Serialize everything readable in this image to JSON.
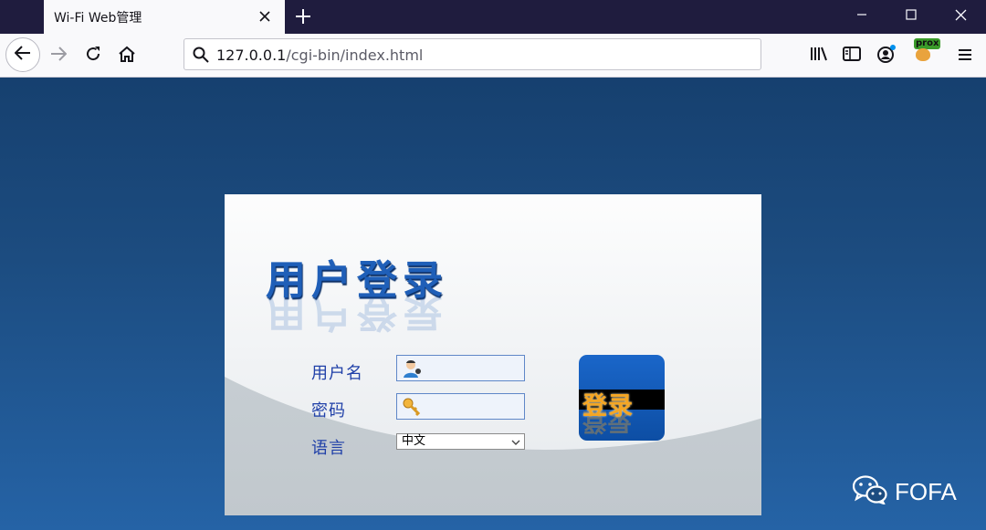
{
  "browser": {
    "tab": {
      "title": "Wi-Fi Web管理"
    },
    "url": {
      "host": "127.0.0.1",
      "path": "/cgi-bin/index.html"
    },
    "extension_badge": "prox"
  },
  "login": {
    "heading": "用户登录",
    "username_label": "用户名",
    "password_label": "密码",
    "language_label": "语言",
    "language_value": "中文",
    "login_button": "登录"
  },
  "watermark": {
    "text": "FOFA"
  },
  "colors": {
    "tabbar": "#1f1c3e",
    "page_bg": "#1c4c80",
    "heading": "#1f5fb8",
    "label": "#2040a8",
    "login_button": "#1a66c9",
    "login_button_text": "#f5a623"
  },
  "icons": {
    "username_field": "user-icon",
    "password_field": "key-icon",
    "watermark": "wechat-icon"
  }
}
